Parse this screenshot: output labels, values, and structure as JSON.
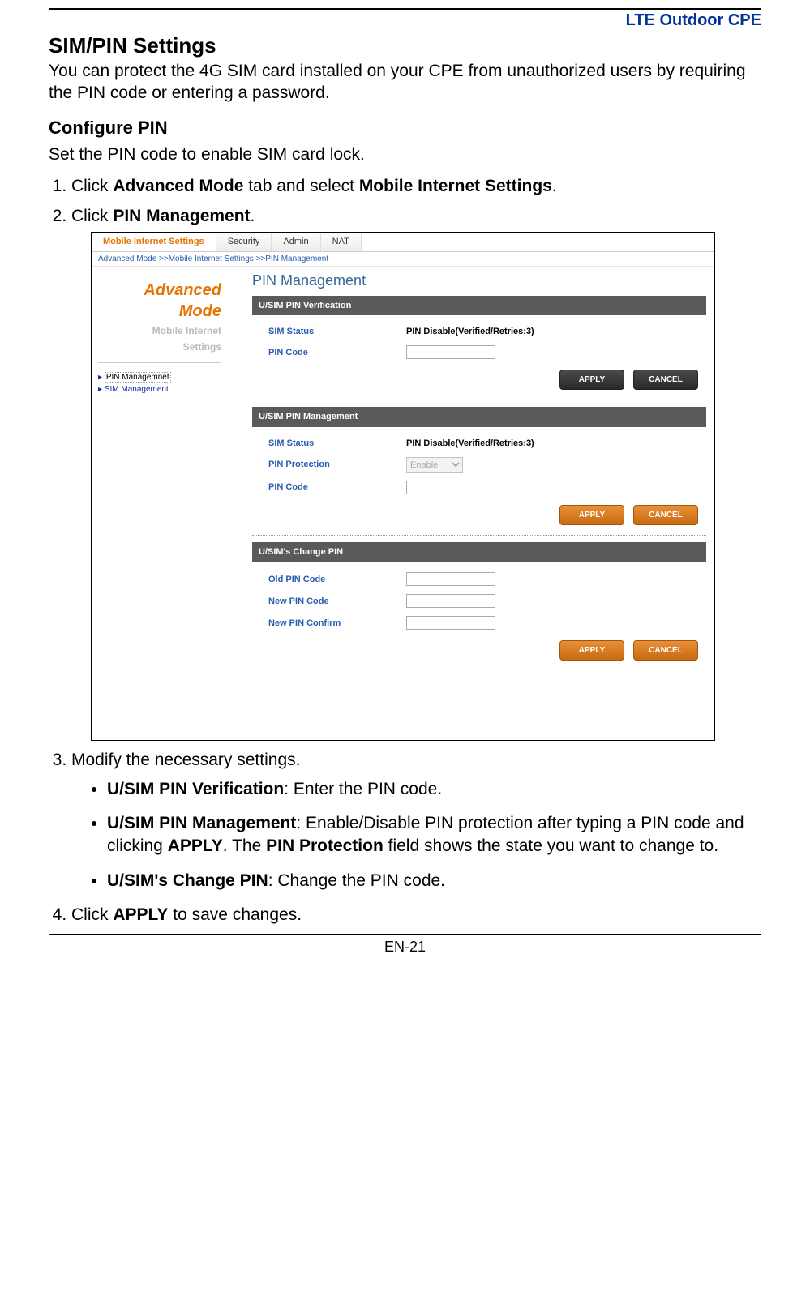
{
  "header": {
    "brand": "LTE Outdoor CPE"
  },
  "title": "SIM/PIN Settings",
  "intro": "You can protect the 4G SIM card installed on your CPE from unauthorized users by requiring the PIN code or entering a password.",
  "section_heading": "Configure PIN",
  "section_text": "Set the PIN code to enable SIM card lock.",
  "steps": {
    "s1_a": "Click ",
    "s1_b": "Advanced Mode",
    "s1_c": " tab and select ",
    "s1_d": "Mobile Internet Settings",
    "s1_e": ".",
    "s2_a": "Click ",
    "s2_b": "PIN Management",
    "s2_c": ".",
    "s3": "Modify the necessary settings.",
    "s4_a": "Click ",
    "s4_b": "APPLY",
    "s4_c": " to save changes."
  },
  "bullets": {
    "b1_a": "U/SIM PIN Verification",
    "b1_b": ": Enter the PIN code.",
    "b2_a": "U/SIM PIN Management",
    "b2_b": ": Enable/Disable PIN protection after typing a PIN code and clicking ",
    "b2_c": "APPLY",
    "b2_d": ". The ",
    "b2_e": "PIN Protection",
    "b2_f": " field shows the state you want to change to.",
    "b3_a": "U/SIM's Change PIN",
    "b3_b": ": Change the PIN code."
  },
  "footer": "EN-21",
  "fig": {
    "tabs": [
      "Mobile Internet Settings",
      "Security",
      "Admin",
      "NAT"
    ],
    "breadcrumb": "Advanced Mode >>Mobile Internet Settings >>PIN Management",
    "side": {
      "adv1": "Advanced",
      "adv2": "Mode",
      "mini1": "Mobile Internet",
      "mini2": "Settings",
      "link1": "PIN Managemnet",
      "link2": "SIM Management"
    },
    "main_title": "PIN Management",
    "panel1": {
      "hdr": "U/SIM PIN Verification",
      "sim_label": "SIM Status",
      "sim_value": "PIN Disable(Verified/Retries:3)",
      "pin_label": "PIN Code"
    },
    "panel2": {
      "hdr": "U/SIM PIN Management",
      "sim_label": "SIM Status",
      "sim_value": "PIN Disable(Verified/Retries:3)",
      "prot_label": "PIN Protection",
      "prot_option": "Enable",
      "pin_label": "PIN Code"
    },
    "panel3": {
      "hdr": "U/SIM's Change PIN",
      "old_label": "Old PIN Code",
      "new_label": "New PIN Code",
      "conf_label": "New PIN Confirm"
    },
    "buttons": {
      "apply": "APPLY",
      "cancel": "CANCEL"
    }
  }
}
